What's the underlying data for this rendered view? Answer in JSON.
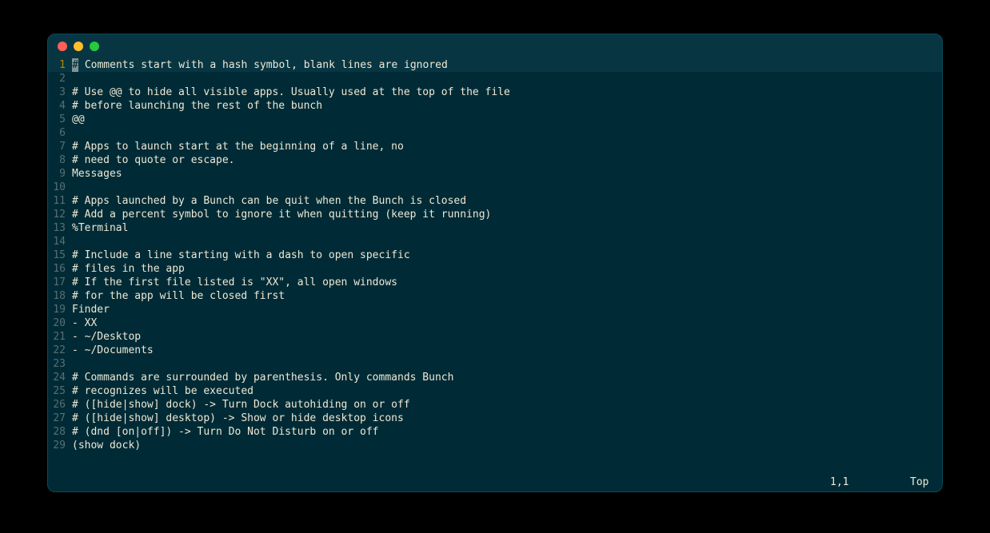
{
  "editor": {
    "lines": [
      "# Comments start with a hash symbol, blank lines are ignored",
      "",
      "# Use @@ to hide all visible apps. Usually used at the top of the file",
      "# before launching the rest of the bunch",
      "@@",
      "",
      "# Apps to launch start at the beginning of a line, no",
      "# need to quote or escape.",
      "Messages",
      "",
      "# Apps launched by a Bunch can be quit when the Bunch is closed",
      "# Add a percent symbol to ignore it when quitting (keep it running)",
      "%Terminal",
      "",
      "# Include a line starting with a dash to open specific",
      "# files in the app",
      "# If the first file listed is \"XX\", all open windows",
      "# for the app will be closed first",
      "Finder",
      "- XX",
      "- ~/Desktop",
      "- ~/Documents",
      "",
      "# Commands are surrounded by parenthesis. Only commands Bunch",
      "# recognizes will be executed",
      "# ([hide|show] dock) -> Turn Dock autohiding on or off",
      "# ([hide|show] desktop) -> Show or hide desktop icons",
      "# (dnd [on|off]) -> Turn Do Not Disturb on or off",
      "(show dock)"
    ],
    "cursor_line": 1,
    "cursor_char": "#",
    "status": {
      "position": "1,1",
      "scroll": "Top"
    }
  }
}
